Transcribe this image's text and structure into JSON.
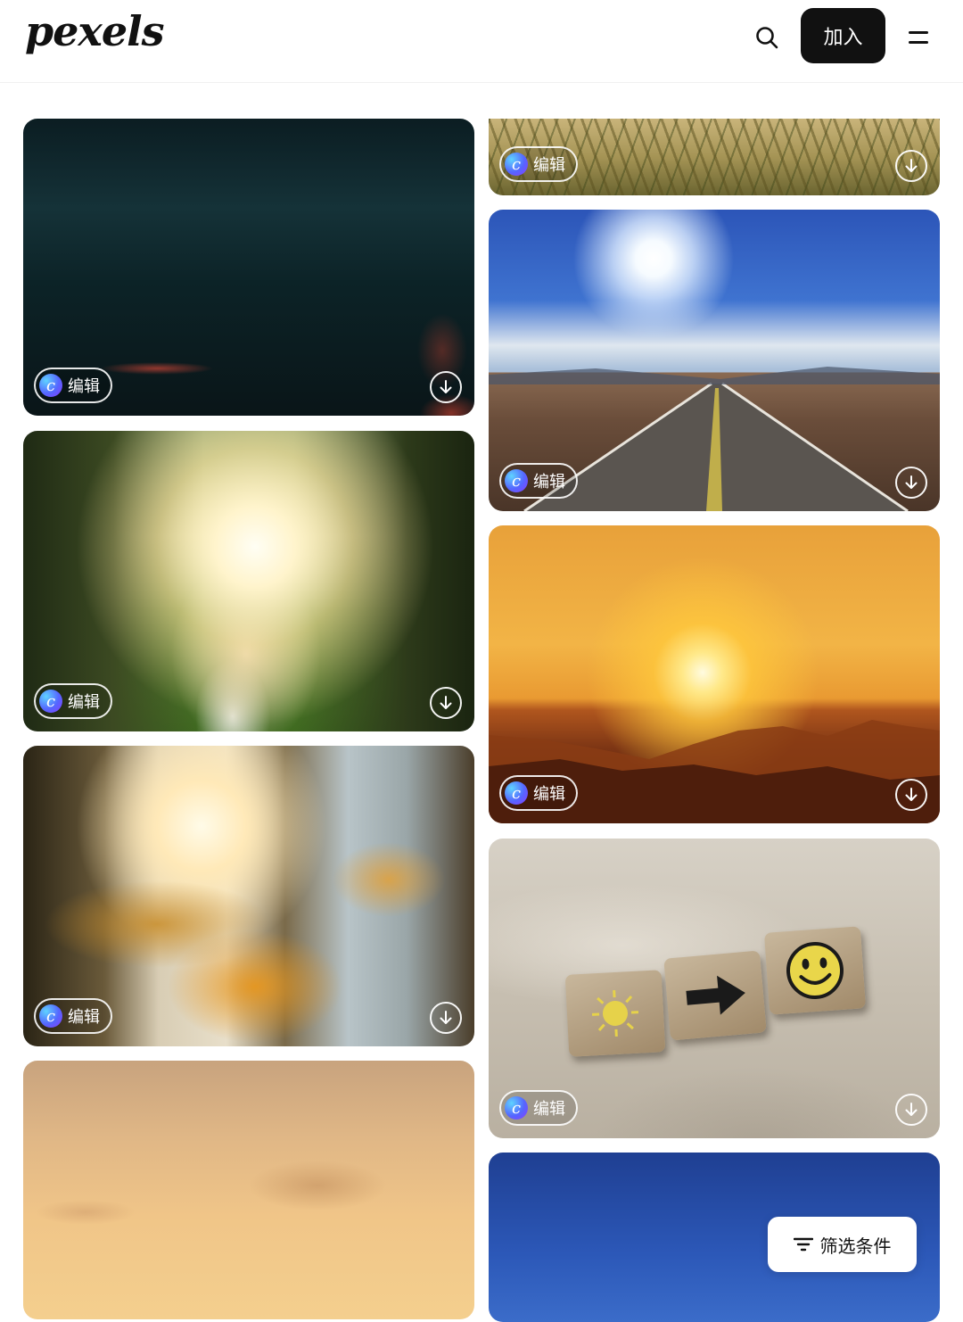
{
  "header": {
    "logo": "pexels",
    "join_label": "加入",
    "search_icon": "search-icon",
    "menu_icon": "menu-icon"
  },
  "photos": {
    "edit_label": "编辑",
    "left": [
      {
        "subject": "water"
      },
      {
        "subject": "girl"
      },
      {
        "subject": "lily"
      },
      {
        "subject": "sky"
      }
    ],
    "right": [
      {
        "subject": "grass"
      },
      {
        "subject": "road"
      },
      {
        "subject": "sunset"
      },
      {
        "subject": "sand-tiles"
      },
      {
        "subject": "blue-sky"
      }
    ]
  },
  "filter": {
    "label": "筛选条件",
    "icon": "filter-icon"
  }
}
